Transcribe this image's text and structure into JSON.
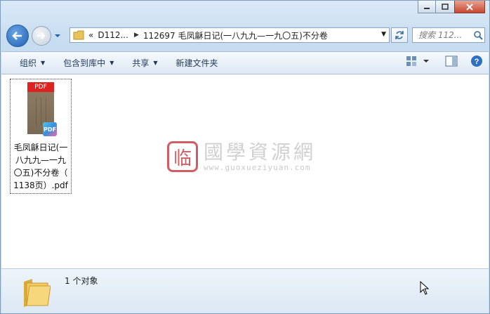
{
  "window": {
    "minimize_label": "minimize",
    "maximize_label": "maximize",
    "close_label": "close"
  },
  "address": {
    "overflow": "«",
    "crumbs": [
      "D112...",
      "112697 毛凤龢日记(一八九九—一九〇五)不分卷"
    ]
  },
  "search": {
    "placeholder": "搜索 112..."
  },
  "toolbar": {
    "organize": "组织",
    "include_library": "包含到库中",
    "share": "共享",
    "new_folder": "新建文件夹"
  },
  "files": [
    {
      "name_lines": [
        "毛凤龢日记(一",
        "八九九—一九",
        "〇五)不分卷（",
        "1138页）.pdf"
      ],
      "type_badge": "PDF"
    }
  ],
  "watermark": {
    "logo_char": "临",
    "title": "國學資源網",
    "url": "www.guoxueziyuan.com"
  },
  "status": {
    "count_text": "1 个对象"
  },
  "colors": {
    "accent": "#1d5fb1",
    "toolbar_text": "#1e395b",
    "close_red": "#c8472f",
    "watermark_red": "#c9414a"
  }
}
